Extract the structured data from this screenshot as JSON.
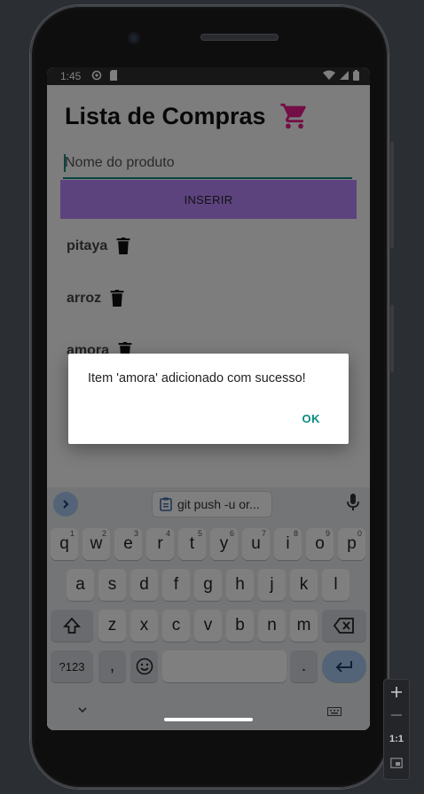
{
  "status_bar": {
    "time": "1:45"
  },
  "app": {
    "title": "Lista de Compras",
    "input_placeholder": "Nome do produto",
    "insert_button": "INSERIR",
    "items": [
      {
        "label": "pitaya"
      },
      {
        "label": "arroz"
      },
      {
        "label": "amora"
      }
    ]
  },
  "dialog": {
    "message": "Item 'amora' adicionado com sucesso!",
    "ok_label": "OK"
  },
  "keyboard": {
    "clipboard_suggestion": "git push -u or...",
    "row1": [
      "q",
      "w",
      "e",
      "r",
      "t",
      "y",
      "u",
      "i",
      "o",
      "p"
    ],
    "row1_hints": [
      "1",
      "2",
      "3",
      "4",
      "5",
      "6",
      "7",
      "8",
      "9",
      "0"
    ],
    "row2": [
      "a",
      "s",
      "d",
      "f",
      "g",
      "h",
      "j",
      "k",
      "l"
    ],
    "row3": [
      "z",
      "x",
      "c",
      "v",
      "b",
      "n",
      "m"
    ],
    "symbols_key": "?123",
    "comma_key": ",",
    "period_key": "."
  },
  "emulator": {
    "zoom_label": "1:1"
  },
  "colors": {
    "accent": "#bb86fc",
    "teal": "#0b8d80",
    "statusbar": "#2f2f2f"
  }
}
